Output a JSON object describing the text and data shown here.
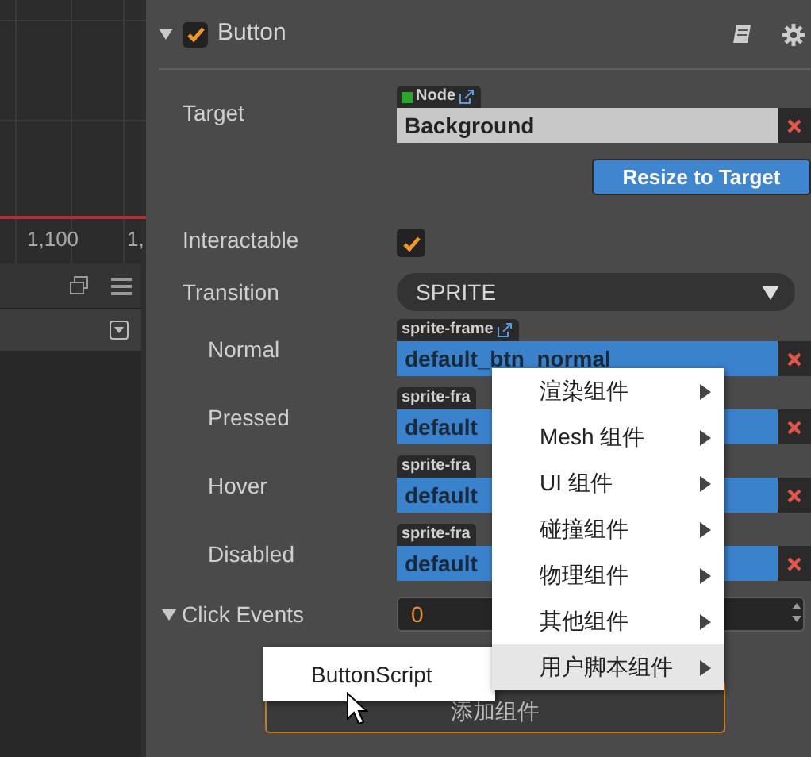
{
  "graph": {
    "axis_labels": [
      "1,100",
      "1,"
    ]
  },
  "component": {
    "title": "Button",
    "expanded": true,
    "enabled": true
  },
  "properties": [
    {
      "kind": "node",
      "label": "Target",
      "tag": "Node",
      "value": "Background"
    },
    {
      "kind": "action",
      "text": "Resize to Target"
    },
    {
      "kind": "checkbox",
      "label": "Interactable",
      "checked": true
    },
    {
      "kind": "select",
      "label": "Transition",
      "value": "SPRITE"
    },
    {
      "kind": "asset",
      "label": "Normal",
      "tag": "sprite-frame",
      "value": "default_btn_normal"
    },
    {
      "kind": "asset",
      "label": "Pressed",
      "tag": "sprite-fra",
      "value": "default"
    },
    {
      "kind": "asset",
      "label": "Hover",
      "tag": "sprite-fra",
      "value": "default"
    },
    {
      "kind": "asset",
      "label": "Disabled",
      "tag": "sprite-fra",
      "value": "default"
    },
    {
      "kind": "list",
      "label": "Click Events",
      "expanded": true,
      "value": "0"
    }
  ],
  "add_button": {
    "label": "添加组件"
  },
  "context_menu": {
    "items": [
      {
        "label": "渲染组件",
        "selected": false
      },
      {
        "label": "Mesh 组件",
        "selected": false
      },
      {
        "label": "UI 组件",
        "selected": false
      },
      {
        "label": "碰撞组件",
        "selected": false
      },
      {
        "label": "物理组件",
        "selected": false
      },
      {
        "label": "其他组件",
        "selected": false
      },
      {
        "label": "用户脚本组件",
        "selected": true
      }
    ]
  },
  "submenu": {
    "items": [
      {
        "label": "ButtonScript",
        "selected": false
      }
    ]
  }
}
